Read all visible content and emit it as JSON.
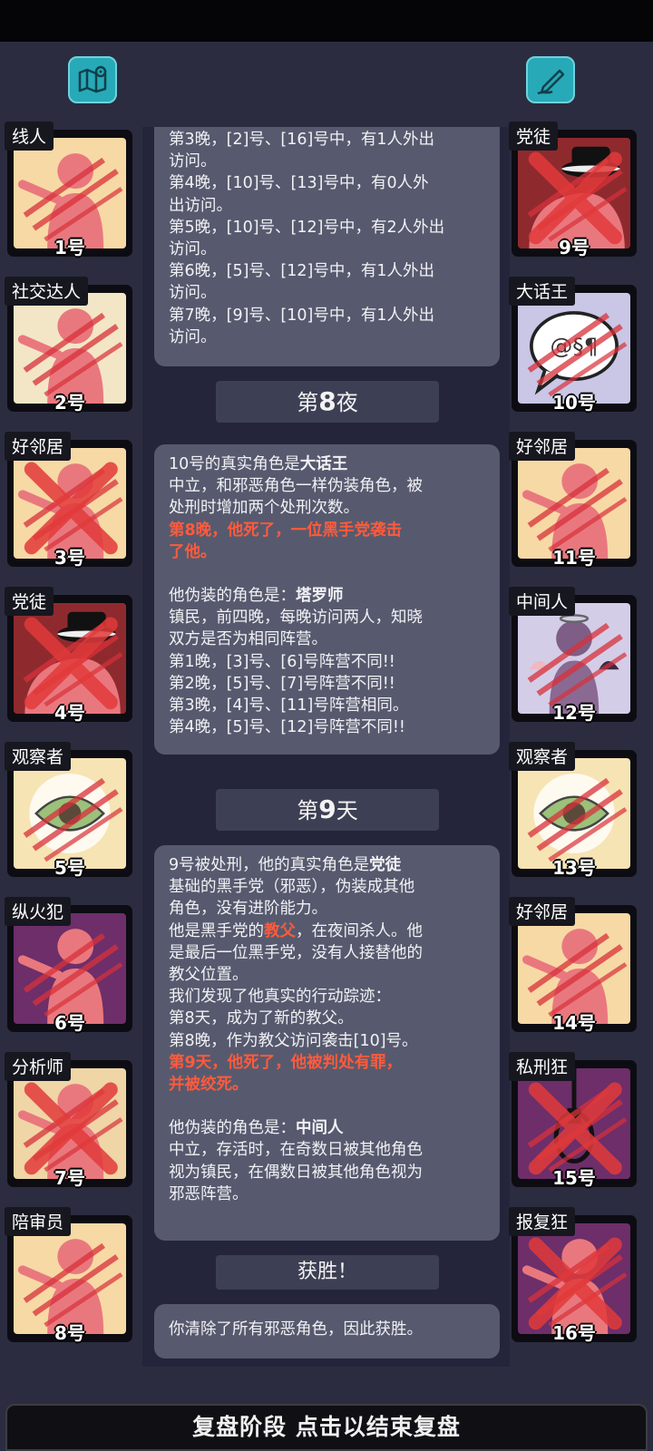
{
  "toolbar": {
    "map_icon": "map-icon",
    "notes_icon": "pen-notes-icon"
  },
  "left_players": [
    {
      "role": "线人",
      "number": "1号",
      "status": "alive",
      "bg": "#f7d9a5",
      "art": "figure-pointing"
    },
    {
      "role": "社交达人",
      "number": "2号",
      "status": "alive",
      "bg": "#f3e6c6",
      "art": "figure-party"
    },
    {
      "role": "好邻居",
      "number": "3号",
      "status": "dead",
      "bg": "#f7d9a5",
      "art": "figure-gift"
    },
    {
      "role": "党徒",
      "number": "4号",
      "status": "dead",
      "bg": "#8e2a2e",
      "art": "figure-hat"
    },
    {
      "role": "观察者",
      "number": "5号",
      "status": "alive",
      "bg": "#f7e4b4",
      "art": "figure-eye"
    },
    {
      "role": "纵火犯",
      "number": "6号",
      "status": "alive",
      "bg": "#6d2e6a",
      "art": "figure-fire"
    },
    {
      "role": "分析师",
      "number": "7号",
      "status": "dead",
      "bg": "#f0d5a6",
      "art": "figure-papers"
    },
    {
      "role": "陪审员",
      "number": "8号",
      "status": "alive",
      "bg": "#f7d9a5",
      "art": "figure-juror"
    }
  ],
  "right_players": [
    {
      "role": "党徒",
      "number": "9号",
      "status": "dead",
      "bg": "#8e2a2e",
      "art": "figure-hat"
    },
    {
      "role": "大话王",
      "number": "10号",
      "status": "alive",
      "bg": "#c9c6e6",
      "art": "speech-bubble"
    },
    {
      "role": "好邻居",
      "number": "11号",
      "status": "alive",
      "bg": "#f7d9a5",
      "art": "figure-gift"
    },
    {
      "role": "中间人",
      "number": "12号",
      "status": "alive",
      "bg": "#d4cde8",
      "art": "figure-wings"
    },
    {
      "role": "观察者",
      "number": "13号",
      "status": "alive",
      "bg": "#f7e4b4",
      "art": "figure-eye"
    },
    {
      "role": "好邻居",
      "number": "14号",
      "status": "alive",
      "bg": "#f7d9a5",
      "art": "figure-gift"
    },
    {
      "role": "私刑狂",
      "number": "15号",
      "status": "dead",
      "bg": "#6d2e6a",
      "art": "noose"
    },
    {
      "role": "报复狂",
      "number": "16号",
      "status": "dead",
      "bg": "#6d2e6a",
      "art": "figure-knife"
    }
  ],
  "log": {
    "bubble1": {
      "lines": [
        "第3晚，[2]号、[16]号中，有1人外出",
        "访问。",
        "第4晚，[10]号、[13]号中，有0人外",
        "出访问。",
        "第5晚，[10]号、[12]号中，有2人外出",
        "访问。",
        "第6晚，[5]号、[12]号中，有1人外出",
        "访问。",
        "第7晚，[9]号、[10]号中，有1人外出",
        "访问。"
      ]
    },
    "night8": {
      "prefix": "第",
      "num": "8",
      "suffix": "夜"
    },
    "bubble2": {
      "l1_a": "10号的真实角色是",
      "l1_b": "大话王",
      "l2": "中立，和邪恶角色一样伪装角色，被",
      "l3": "处刑时增加两个处刑次数。",
      "red1": "第8晚，他死了，一位黑手党袭击",
      "red2": "了他。",
      "l4_a": "他伪装的角色是：",
      "l4_b": "塔罗师",
      "l5": "镇民，前四晚，每晚访问两人，知晓",
      "l6": "双方是否为相同阵营。",
      "l7": "第1晚，[3]号、[6]号阵营不同!!",
      "l8": "第2晚，[5]号、[7]号阵营不同!!",
      "l9": "第3晚，[4]号、[11]号阵营相同。",
      "l10": "第4晚，[5]号、[12]号阵营不同!!"
    },
    "day9": {
      "prefix": "第",
      "num": "9",
      "suffix": "天"
    },
    "bubble3": {
      "l1_a": "9号被处刑，他的真实角色是",
      "l1_b": "党徒",
      "l2": "基础的黑手党（邪恶），伪装成其他",
      "l3": "角色，没有进阶能力。",
      "l4_a": "他是黑手党的",
      "l4_b": "教父",
      "l4_c": "，在夜间杀人。他",
      "l5": "是最后一位黑手党，没有人接替他的",
      "l6": "教父位置。",
      "l7": "我们发现了他真实的行动踪迹：",
      "l8": "第8天，成为了新的教父。",
      "l9": "第8晚，作为教父访问袭击[10]号。",
      "red1": "第9天，他死了，他被判处有罪，",
      "red2": "并被绞死。",
      "l10_a": "他伪装的角色是：",
      "l10_b": "中间人",
      "l11": "中立，存活时，在奇数日被其他角色",
      "l12": "视为镇民，在偶数日被其他角色视为",
      "l13": "邪恶阵营。"
    },
    "victory_header": "获胜！",
    "victory_text": "你清除了所有邪恶角色，因此获胜。"
  },
  "bottom_button": "复盘阶段 点击以结束复盘",
  "colors": {
    "accent_teal": "#27a9b8",
    "highlight_red": "#ff5a3c",
    "card_border": "#0c0c12"
  }
}
